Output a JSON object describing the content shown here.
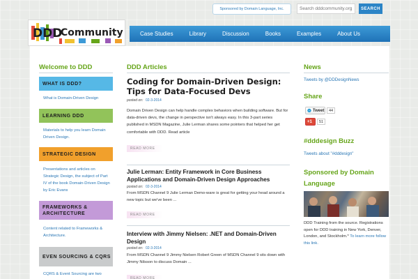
{
  "header": {
    "sponsor": "Sponsored by Domain Language, Inc.",
    "search_placeholder": "Search dddcommunity.org",
    "search_button": "SEARCH",
    "logo_text": "Community",
    "logo_letters": "DDD"
  },
  "nav": [
    "Case Studies",
    "Library",
    "Discussion",
    "Books",
    "Examples",
    "About Us"
  ],
  "sidebar": {
    "title": "Welcome to DDD",
    "sections": [
      {
        "label": "WHAT IS DDD?",
        "desc": "What is Domain-Driven Design",
        "color": "#56b8e6"
      },
      {
        "label": "LEARNING DDD",
        "desc": "Materials to help you learn Domain Driven Design.",
        "color": "#92c35a"
      },
      {
        "label": "STRATEGIC DESIGN",
        "desc": "Presentations and articles on Strategic Design, the subject of Part IV of the book Domain-Driven Design by Eric Evans",
        "color": "#f1a02c"
      },
      {
        "label": "FRAMEWORKS & ARCHITECTURE",
        "desc": "Content related to Frameworks & Architecture.",
        "color": "#c39ad8"
      },
      {
        "label": "EVEN SOURCING & CQRS",
        "desc": "CQRS & Event Sourcing are two",
        "color": "#c9cbcc"
      }
    ]
  },
  "articles": {
    "title": "DDD Articles",
    "date_label": "posted on:",
    "read_more": "READ MORE",
    "items": [
      {
        "title": "Coding for Domain-Driven Design: Tips for Data-Focused Devs",
        "date": "02-3-2014",
        "body": "Domain Driven Design can help handle complex behaviors when building software. But for data-driven devs, the change in perspective isn't always easy. In this 3-part series published in MSDN Magazine, Julie Lerman shares some pointers that helped her get comfortable with DDD. Read article"
      },
      {
        "title": "Julie Lerman: Entity Framework in Core Business Applications and Domain-Driven Design Approaches",
        "date": "02-3-2014",
        "body": "From MSDN Channel 9 Julie Lerman Demo-ware is great for getting your head around a new topic but we've been ..."
      },
      {
        "title": "Interview with Jimmy Nielsen: .NET and Domain-Driven Design",
        "date": "02-3-2014",
        "body": "From MSDN Channel 9 Jimmy Nielsen Robert Green of MSDN Channel 9 sits down with Jimmy Nilsson to discuss Domain ..."
      }
    ]
  },
  "right": {
    "news_title": "News",
    "news_link": "Tweets by @DDDesignNews",
    "share_title": "Share",
    "tweet_label": "Tweet",
    "tweet_count": "44",
    "gplus_label": "+1",
    "gplus_count": "51",
    "buzz_title": "#dddesign Buzz",
    "buzz_link": "Tweets about \"#dddesign\"",
    "sponsor_title": "Sponsored by Domain Language",
    "sponsor_text": "DDD Training from the source. Registrations open for DDD training in New York, Denver, London, and Stockholm.*",
    "sponsor_link": "To learn more follow this link."
  }
}
